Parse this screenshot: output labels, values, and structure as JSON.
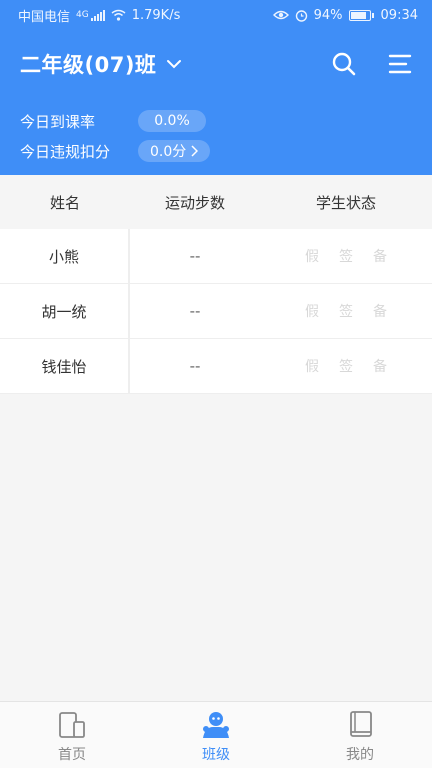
{
  "status_bar": {
    "carrier": "中国电信",
    "network": "4G",
    "speed": "1.79K/s",
    "battery": "94%",
    "time": "09:34"
  },
  "header": {
    "class_title": "二年级(07)班",
    "background_color": "#3f8ef7"
  },
  "stats": {
    "attendance_label": "今日到课率",
    "attendance_value": "0.0%",
    "violation_label": "今日违规扣分",
    "violation_value": "0.0分"
  },
  "table": {
    "headers": [
      "姓名",
      "运动步数",
      "学生状态"
    ],
    "rows": [
      {
        "name": "小熊",
        "steps": "--",
        "status": [
          "假",
          "签",
          "备"
        ]
      },
      {
        "name": "胡一统",
        "steps": "--",
        "status": [
          "假",
          "签",
          "备"
        ]
      },
      {
        "name": "钱佳怡",
        "steps": "--",
        "status": [
          "假",
          "签",
          "备"
        ]
      }
    ]
  },
  "tabbar": {
    "items": [
      {
        "label": "首页",
        "icon": "home-icon"
      },
      {
        "label": "班级",
        "icon": "class-icon"
      },
      {
        "label": "我的",
        "icon": "book-icon"
      }
    ],
    "active_index": 1
  }
}
